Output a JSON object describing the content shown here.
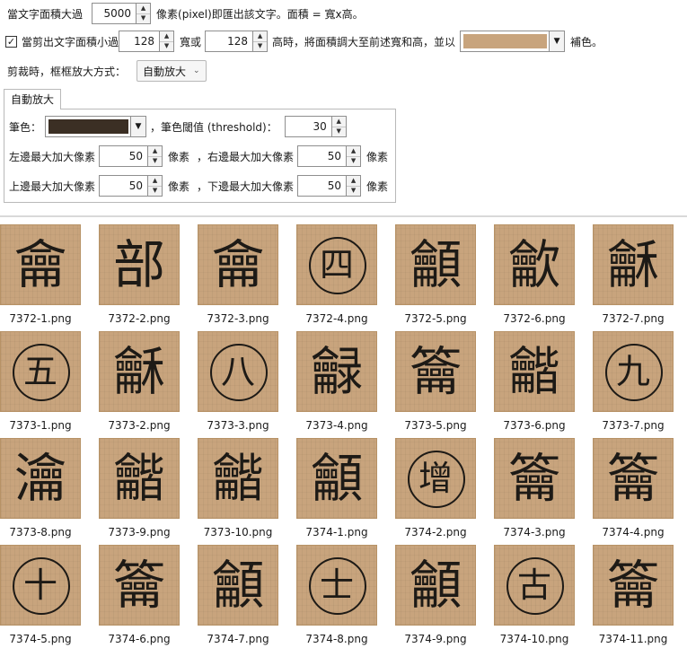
{
  "settings": {
    "row1": {
      "prefix": "當文字面積大過",
      "area_value": "5000",
      "suffix": "像素(pixel)即匯出該文字。面積 = 寬x高。"
    },
    "row2": {
      "label_a": "當剪出文字面積小過",
      "width_value": "128",
      "label_b": "寬或",
      "height_value": "128",
      "label_c": "高時，將面積調大至前述寬和高，並以",
      "fill_color": "#c8a47d",
      "label_d": "補色。"
    },
    "row3": {
      "label": "剪裁時，框框放大方式：",
      "mode_value": "自動放大"
    },
    "tab_label": "自動放大",
    "group": {
      "pen_label": "筆色：",
      "pen_color": "#3b2f24",
      "threshold_label": "，筆色閾值 (threshold)：",
      "threshold_value": "30",
      "left_label": "左邊最大加大像素",
      "left_value": "50",
      "left_unit": "像素",
      "right_label": "，右邊最大加大像素",
      "right_value": "50",
      "right_unit": "像素",
      "top_label": "上邊最大加大像素",
      "top_value": "50",
      "top_unit": "像素",
      "bottom_label": "，下邊最大加大像素",
      "bottom_value": "50",
      "bottom_unit": "像素"
    }
  },
  "thumbnails": [
    {
      "glyph": "龠",
      "file": "7372-1.png",
      "circled": false
    },
    {
      "glyph": "部",
      "file": "7372-2.png",
      "circled": false
    },
    {
      "glyph": "龠",
      "file": "7372-3.png",
      "circled": false
    },
    {
      "glyph": "四",
      "file": "7372-4.png",
      "circled": true
    },
    {
      "glyph": "龥",
      "file": "7372-5.png",
      "circled": false
    },
    {
      "glyph": "龡",
      "file": "7372-6.png",
      "circled": false
    },
    {
      "glyph": "龢",
      "file": "7372-7.png",
      "circled": false
    },
    {
      "glyph": "五",
      "file": "7373-1.png",
      "circled": true
    },
    {
      "glyph": "龢",
      "file": "7373-2.png",
      "circled": false
    },
    {
      "glyph": "八",
      "file": "7373-3.png",
      "circled": true
    },
    {
      "glyph": "龣",
      "file": "7373-4.png",
      "circled": false
    },
    {
      "glyph": "籥",
      "file": "7373-5.png",
      "circled": false
    },
    {
      "glyph": "龤",
      "file": "7373-6.png",
      "circled": false
    },
    {
      "glyph": "九",
      "file": "7373-7.png",
      "circled": true
    },
    {
      "glyph": "瀹",
      "file": "7373-8.png",
      "circled": false
    },
    {
      "glyph": "龤",
      "file": "7373-9.png",
      "circled": false
    },
    {
      "glyph": "龤",
      "file": "7373-10.png",
      "circled": false
    },
    {
      "glyph": "龥",
      "file": "7374-1.png",
      "circled": false
    },
    {
      "glyph": "增",
      "file": "7374-2.png",
      "circled": true
    },
    {
      "glyph": "籥",
      "file": "7374-3.png",
      "circled": false
    },
    {
      "glyph": "籥",
      "file": "7374-4.png",
      "circled": false
    },
    {
      "glyph": "十",
      "file": "7374-5.png",
      "circled": true
    },
    {
      "glyph": "籥",
      "file": "7374-6.png",
      "circled": false
    },
    {
      "glyph": "龥",
      "file": "7374-7.png",
      "circled": false
    },
    {
      "glyph": "士",
      "file": "7374-8.png",
      "circled": true
    },
    {
      "glyph": "龥",
      "file": "7374-9.png",
      "circled": false
    },
    {
      "glyph": "古",
      "file": "7374-10.png",
      "circled": true
    },
    {
      "glyph": "籥",
      "file": "7374-11.png",
      "circled": false
    }
  ]
}
